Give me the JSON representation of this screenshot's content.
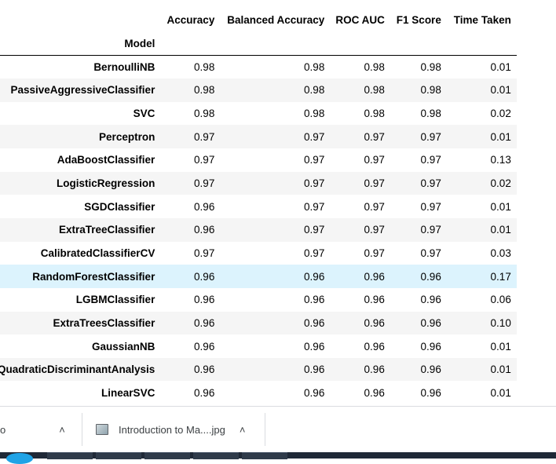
{
  "table": {
    "columns": [
      "Accuracy",
      "Balanced Accuracy",
      "ROC AUC",
      "F1 Score",
      "Time Taken"
    ],
    "index_label": "Model",
    "rows": [
      {
        "model": "BernoulliNB",
        "values": [
          "0.98",
          "0.98",
          "0.98",
          "0.98",
          "0.01"
        ]
      },
      {
        "model": "PassiveAggressiveClassifier",
        "values": [
          "0.98",
          "0.98",
          "0.98",
          "0.98",
          "0.01"
        ]
      },
      {
        "model": "SVC",
        "values": [
          "0.98",
          "0.98",
          "0.98",
          "0.98",
          "0.02"
        ]
      },
      {
        "model": "Perceptron",
        "values": [
          "0.97",
          "0.97",
          "0.97",
          "0.97",
          "0.01"
        ]
      },
      {
        "model": "AdaBoostClassifier",
        "values": [
          "0.97",
          "0.97",
          "0.97",
          "0.97",
          "0.13"
        ]
      },
      {
        "model": "LogisticRegression",
        "values": [
          "0.97",
          "0.97",
          "0.97",
          "0.97",
          "0.02"
        ]
      },
      {
        "model": "SGDClassifier",
        "values": [
          "0.96",
          "0.97",
          "0.97",
          "0.97",
          "0.01"
        ]
      },
      {
        "model": "ExtraTreeClassifier",
        "values": [
          "0.96",
          "0.97",
          "0.97",
          "0.97",
          "0.01"
        ]
      },
      {
        "model": "CalibratedClassifierCV",
        "values": [
          "0.97",
          "0.97",
          "0.97",
          "0.97",
          "0.03"
        ]
      },
      {
        "model": "RandomForestClassifier",
        "values": [
          "0.96",
          "0.96",
          "0.96",
          "0.96",
          "0.17"
        ],
        "highlighted": true
      },
      {
        "model": "LGBMClassifier",
        "values": [
          "0.96",
          "0.96",
          "0.96",
          "0.96",
          "0.06"
        ]
      },
      {
        "model": "ExtraTreesClassifier",
        "values": [
          "0.96",
          "0.96",
          "0.96",
          "0.96",
          "0.10"
        ]
      },
      {
        "model": "GaussianNB",
        "values": [
          "0.96",
          "0.96",
          "0.96",
          "0.96",
          "0.01"
        ]
      },
      {
        "model": "QuadraticDiscriminantAnalysis",
        "values": [
          "0.96",
          "0.96",
          "0.96",
          "0.96",
          "0.01"
        ]
      },
      {
        "model": "LinearSVC",
        "values": [
          "0.96",
          "0.96",
          "0.96",
          "0.96",
          "0.01"
        ]
      }
    ]
  },
  "download_bar": {
    "items": [
      {
        "label": "o",
        "icon": "chevron-up-icon"
      },
      {
        "label": "Introduction to Ma....jpg",
        "file_icon": "image-file-icon",
        "icon": "chevron-up-icon"
      }
    ]
  },
  "colors": {
    "highlight_row": "#dcf3fd",
    "striped_row": "#f5f5f5",
    "taskbar": "#1f2937"
  }
}
